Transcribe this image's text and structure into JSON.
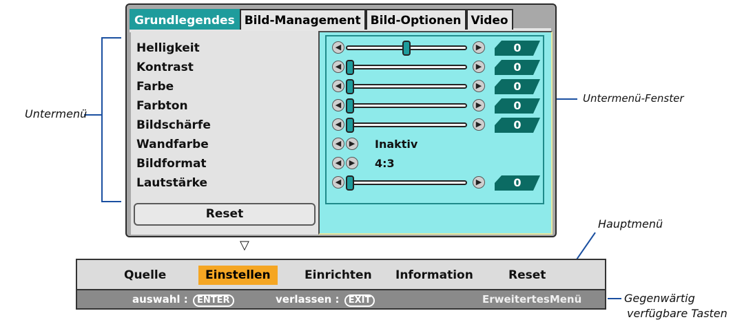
{
  "tabs": [
    "Grundlegendes",
    "Bild-Management",
    "Bild-Optionen",
    "Video"
  ],
  "submenu": {
    "items": [
      {
        "label": "Helligkeit",
        "type": "slider",
        "level": 0.5,
        "value": "0"
      },
      {
        "label": "Kontrast",
        "type": "slider",
        "level": 0,
        "value": "0"
      },
      {
        "label": "Farbe",
        "type": "slider",
        "level": 0,
        "value": "0"
      },
      {
        "label": "Farbton",
        "type": "slider",
        "level": 0,
        "value": "0"
      },
      {
        "label": "Bildschärfe",
        "type": "slider",
        "level": 0,
        "value": "0"
      },
      {
        "label": "Wandfarbe",
        "type": "select",
        "value": "Inaktiv"
      },
      {
        "label": "Bildformat",
        "type": "select",
        "value": "4:3"
      },
      {
        "label": "Lautstärke",
        "type": "slider",
        "level": 0,
        "value": "0"
      }
    ],
    "reset_label": "Reset"
  },
  "main_menu": {
    "items": [
      "Quelle",
      "Einstellen",
      "Einrichten",
      "Information",
      "Reset"
    ],
    "active": "Einstellen"
  },
  "status_bar": {
    "select_label": "auswahl :",
    "select_key": "ENTER",
    "exit_label": "verlassen :",
    "exit_key": "EXIT",
    "advanced_label": "ErweitertesMenü"
  },
  "annotations": {
    "untermenu": "Untermenü",
    "untermenu_fenster": "Untermenü-Fenster",
    "hauptmenu": "Hauptmenü",
    "tasten_line1": "Gegenwärtig",
    "tasten_line2": "verfügbare Tasten"
  },
  "colors": {
    "tab_active": "#1e9c9c",
    "right_panel": "#8eeaea",
    "value_box": "#0b6b63",
    "menu_active": "#f5a623"
  },
  "icons": {
    "arrow_left": "left-arrow-icon",
    "arrow_right": "right-arrow-icon",
    "down": "down-triangle-icon"
  }
}
